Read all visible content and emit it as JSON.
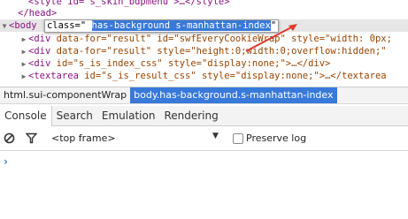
{
  "elements_panel": {
    "lines": [
      {
        "text": "<style id=\"s_skin_bdpmenu\">…</style>"
      },
      {
        "text": "</head>"
      },
      {
        "tag_open": "<body",
        "attr_name": "class=\"",
        "attr_value": "has-background s-manhattan-index",
        "closing_quote": "\""
      },
      {
        "tag_open": "<div",
        "attrs": " data-for=\"result\" id=\"swfEveryCookieWrap\" style=\"width: 0px;"
      },
      {
        "tag_open": "<div",
        "attrs": " data-for=\"result\" style=\"height:0;width:0;overflow:hidden;\""
      },
      {
        "tag_open": "<div",
        "attrs": " id=\"s_is_index_css\" style=\"display:none;\">…</div>"
      },
      {
        "tag_open": "<textarea",
        "attrs": " id=\"s_is_result_css\" style=\"display:none;\">…</textarea"
      }
    ]
  },
  "breadcrumbs": [
    "html.sui-componentWrap",
    "body.has-background.s-manhattan-index"
  ],
  "tabs": [
    "Console",
    "Search",
    "Emulation",
    "Rendering"
  ],
  "console_toolbar": {
    "frame_select": "<top frame>",
    "preserve_log_label": "Preserve log",
    "preserve_log_checked": false
  },
  "prompt_symbol": "›",
  "colors": {
    "selection": "#3879d9",
    "tag": "#881280",
    "attribute": "#994500",
    "annotation_arrow": "#e03a2e"
  }
}
